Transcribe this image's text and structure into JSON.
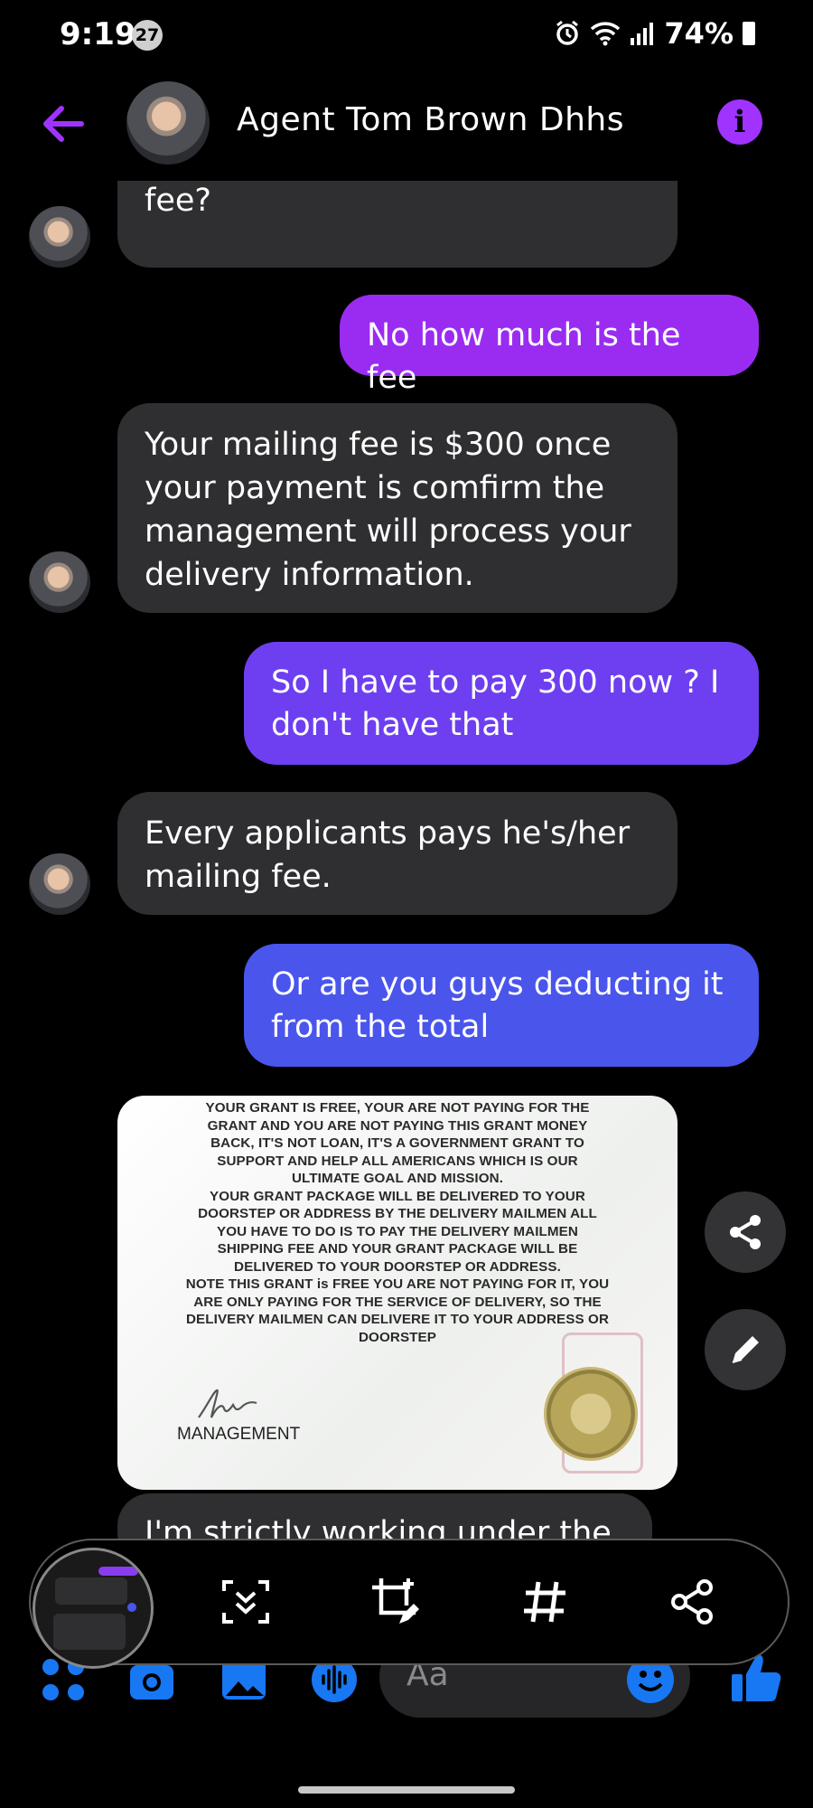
{
  "status_bar": {
    "time": "9:19",
    "notification_count": "27",
    "battery": "74%"
  },
  "header": {
    "contact_name": "Agent Tom Brown Dhhs"
  },
  "messages": [
    {
      "from": "them",
      "text": "Are you aware of the delivery fee?"
    },
    {
      "from": "me",
      "text": "No how much is the fee"
    },
    {
      "from": "them",
      "text": "Your mailing fee is $300 once your payment is comfirm the management will process your delivery information."
    },
    {
      "from": "me",
      "text": "So I have to pay 300 now ? I don't have that"
    },
    {
      "from": "them",
      "text": "Every applicants pays he's/her mailing fee."
    },
    {
      "from": "me",
      "text": "Or are you guys deducting it from the total"
    }
  ],
  "grant_image": {
    "lines": [
      "YOUR GRANT IS FREE, YOUR ARE NOT PAYING FOR THE",
      "GRANT AND YOU ARE NOT PAYING THIS GRANT MONEY",
      "BACK, IT'S NOT LOAN, IT'S A GOVERNMENT GRANT TO",
      "SUPPORT AND HELP ALL AMERICANS WHICH IS OUR",
      "ULTIMATE GOAL AND MISSION.",
      "YOUR GRANT PACKAGE WILL BE DELIVERED TO YOUR",
      "DOORSTEP OR ADDRESS BY THE DELIVERY MAILMEN ALL",
      "YOU HAVE TO DO IS TO PAY THE DELIVERY MAILMEN",
      "SHIPPING FEE AND YOUR GRANT PACKAGE WILL BE",
      "DELIVERED TO YOUR DOORSTEP OR ADDRESS.",
      "NOTE THIS GRANT is FREE YOU ARE NOT PAYING FOR IT, YOU",
      "ARE ONLY PAYING FOR THE SERVICE OF DELIVERY, SO THE",
      "DELIVERY MAILMEN  CAN DELIVERE IT TO YOUR ADDRESS OR",
      "DOORSTEP"
    ],
    "signature_label": "MANAGEMENT"
  },
  "partial_message": "I'm strictly working under the",
  "composer": {
    "placeholder": "Aa"
  },
  "colors": {
    "accent": "#a033ff",
    "bubble_in": "#2f2f31",
    "bubble_out_top": "#9a2cf2",
    "bubble_out_mid": "#6d3ff0",
    "bubble_out_bottom": "#4a55ec",
    "messenger_blue": "#1877f2"
  },
  "icons": {
    "back": "arrow-left-icon",
    "info": "info-icon",
    "share": "share-icon",
    "edit": "pencil-icon",
    "scroll_capture": "scroll-capture-icon",
    "crop_edit": "crop-edit-icon",
    "tag": "hashtag-icon",
    "menu": "four-dots-icon",
    "camera": "camera-icon",
    "gallery": "gallery-icon",
    "voice": "voice-icon",
    "emoji": "emoji-icon",
    "like": "thumbs-up-icon"
  }
}
